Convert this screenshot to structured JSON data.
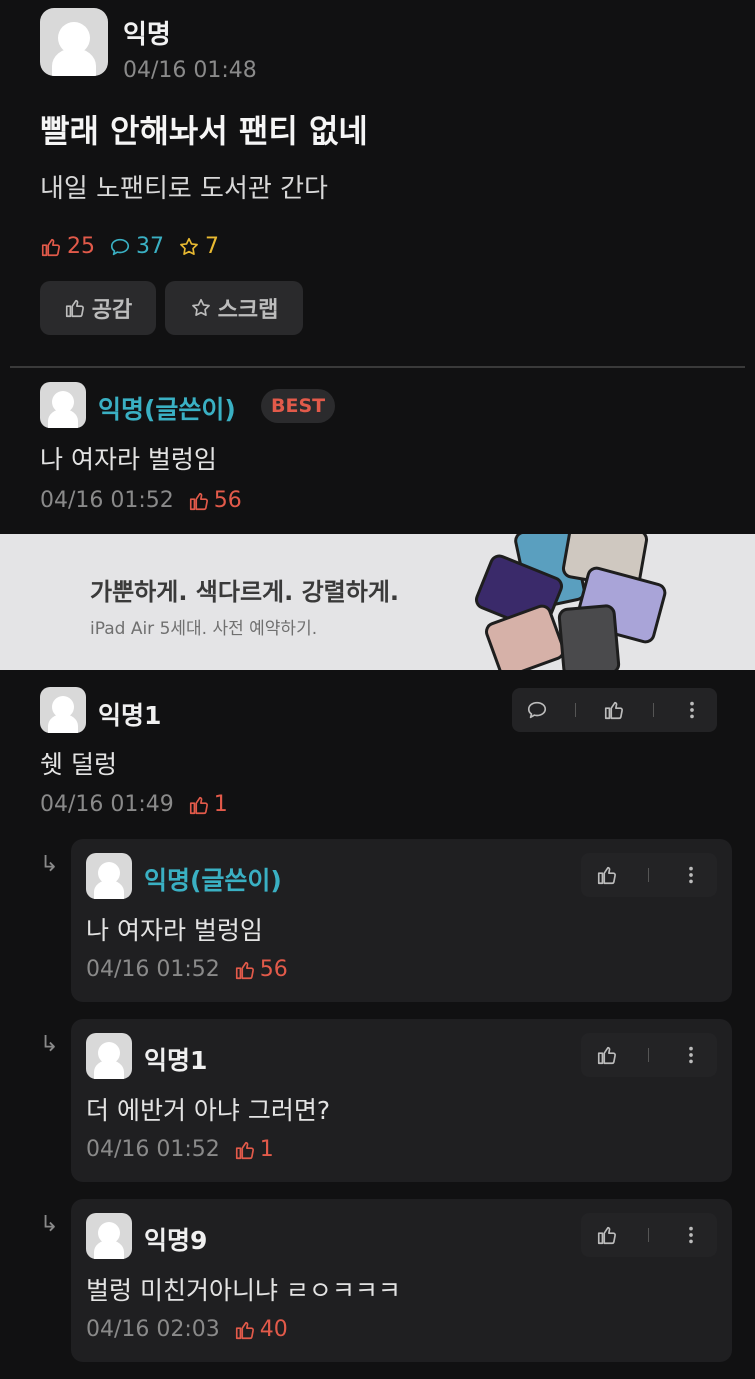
{
  "post": {
    "author": "익명",
    "time": "04/16 01:48",
    "title": "빨래 안해놔서 팬티 없네",
    "body": "내일 노팬티로 도서관 간다",
    "likes": "25",
    "comments": "37",
    "scraps": "7",
    "like_button": "공감",
    "scrap_button": "스크랩"
  },
  "best_comment": {
    "author": "익명(글쓴이)",
    "badge": "BEST",
    "text": "나 여자라 벌렁임",
    "time": "04/16 01:52",
    "likes": "56"
  },
  "ad": {
    "title": "가뿐하게. 색다르게. 강렬하게.",
    "subtitle": "iPad Air 5세대. 사전 예약하기."
  },
  "comment": {
    "author": "익명1",
    "text": "쉣 덜렁",
    "time": "04/16 01:49",
    "likes": "1"
  },
  "replies": [
    {
      "author": "익명(글쓴이)",
      "text": "나 여자라 벌렁임",
      "time": "04/16 01:52",
      "likes": "56"
    },
    {
      "author": "익명1",
      "text": "더 에반거 아냐 그러면?",
      "time": "04/16 01:52",
      "likes": "1"
    },
    {
      "author": "익명9",
      "text": "벌렁 미친거아니냐 ㄹㅇㅋㅋㅋ",
      "time": "04/16 02:03",
      "likes": "40"
    }
  ],
  "reply_arrow": "↳",
  "colors": {
    "like": "#e25a4a",
    "comment": "#3ab0c3",
    "scrap": "#e8b931",
    "op": "#3ab0c3"
  },
  "icons": [
    "thumbs-up-icon",
    "comment-bubble-icon",
    "star-icon",
    "more-vertical-icon",
    "avatar-icon"
  ]
}
